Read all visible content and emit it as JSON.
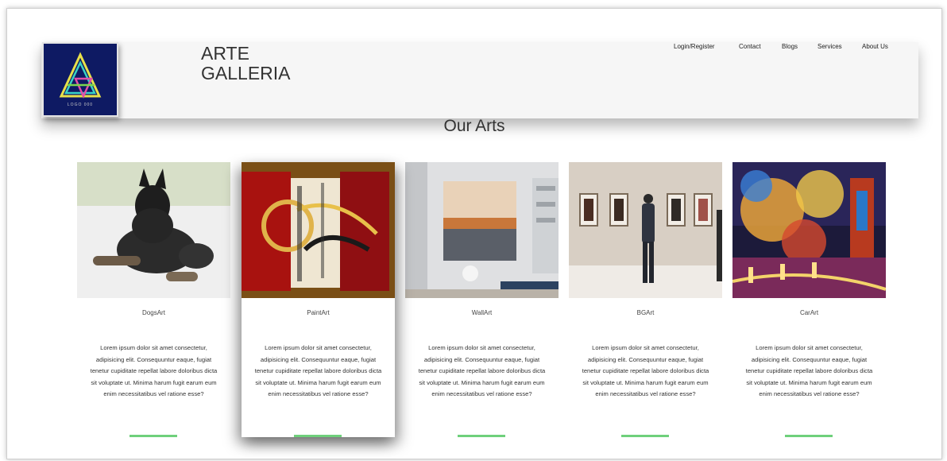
{
  "brand": {
    "line1": "ARTE",
    "line2": "GALLERIA",
    "logo_tag": "LOGO 000"
  },
  "nav": [
    {
      "label": "Login/Register"
    },
    {
      "label": "Contact"
    },
    {
      "label": "Blogs"
    },
    {
      "label": "Services"
    },
    {
      "label": "About Us"
    }
  ],
  "section": {
    "title": "Our Arts"
  },
  "cards": [
    {
      "title": "DogsArt",
      "image": "dog-photo",
      "desc": "Lorem ipsum dolor sit amet consectetur, adipisicing elit. Consequuntur eaque, fugiat tenetur cupiditate repellat labore doloribus dicta sit voluptate ut. Minima harum fugit earum eum enim necessitatibus vel ratione esse?"
    },
    {
      "title": "PaintArt",
      "image": "abstract-painting",
      "desc": "Lorem ipsum dolor sit amet consectetur, adipisicing elit. Consequuntur eaque, fugiat tenetur cupiditate repellat labore doloribus dicta sit voluptate ut. Minima harum fugit earum eum enim necessitatibus vel ratione esse?"
    },
    {
      "title": "WallArt",
      "image": "wall-art-room",
      "desc": "Lorem ipsum dolor sit amet consectetur, adipisicing elit. Consequuntur eaque, fugiat tenetur cupiditate repellat labore doloribus dicta sit voluptate ut. Minima harum fugit earum eum enim necessitatibus vel ratione esse?"
    },
    {
      "title": "BGArt",
      "image": "gallery-visitors",
      "desc": "Lorem ipsum dolor sit amet consectetur, adipisicing elit. Consequuntur eaque, fugiat tenetur cupiditate repellat labore doloribus dicta sit voluptate ut. Minima harum fugit earum eum enim necessitatibus vel ratione esse?"
    },
    {
      "title": "CarArt",
      "image": "colorful-street-painting",
      "desc": "Lorem ipsum dolor sit amet consectetur, adipisicing elit. Consequuntur eaque, fugiat tenetur cupiditate repellat labore doloribus dicta sit voluptate ut. Minima harum fugit earum eum enim necessitatibus vel ratione esse?"
    }
  ],
  "colors": {
    "accent_bar": "#6fd07b",
    "logo_bg": "#0e1a63",
    "header_bg": "#f6f6f6"
  }
}
